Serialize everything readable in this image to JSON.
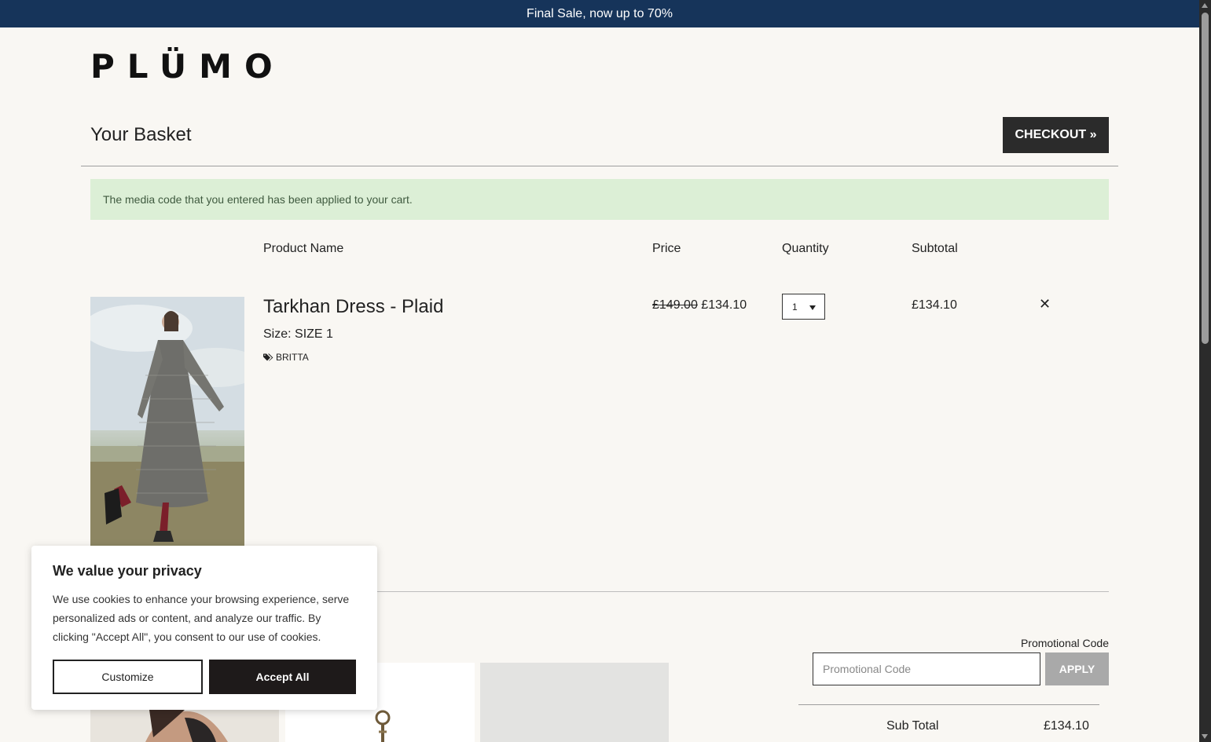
{
  "announcement": {
    "text": "Final Sale, now up to 70%"
  },
  "brand": {
    "logo_text": "PLÜMO"
  },
  "basket": {
    "title": "Your Basket",
    "checkout_label": "CHECKOUT »",
    "notice": "The media code that you entered has been applied to your cart."
  },
  "table": {
    "headers": {
      "product": "Product Name",
      "price": "Price",
      "quantity": "Quantity",
      "subtotal": "Subtotal"
    },
    "items": [
      {
        "name": "Tarkhan Dress - Plaid",
        "size": "Size: SIZE 1",
        "tag": "BRITTA",
        "price_old": "£149.00",
        "price_new": "£134.10",
        "quantity": "1",
        "subtotal": "£134.10",
        "remove_icon": "close-icon"
      }
    ]
  },
  "promo": {
    "label": "Promotional Code",
    "placeholder": "Promotional Code",
    "apply_label": "APPLY"
  },
  "totals": {
    "sub_total_label": "Sub Total",
    "sub_total_value": "£134.10"
  },
  "cookie": {
    "title": "We value your privacy",
    "body": "We use cookies to enhance your browsing experience, serve personalized ads or content, and analyze our traffic. By clicking \"Accept All\", you consent to our use of cookies.",
    "customize_label": "Customize",
    "accept_label": "Accept All"
  },
  "colors": {
    "announcement_bg": "#16345a",
    "notice_bg": "#dcefd6",
    "checkout_bg": "#2b2b2b",
    "apply_bg": "#a9a9a9"
  }
}
